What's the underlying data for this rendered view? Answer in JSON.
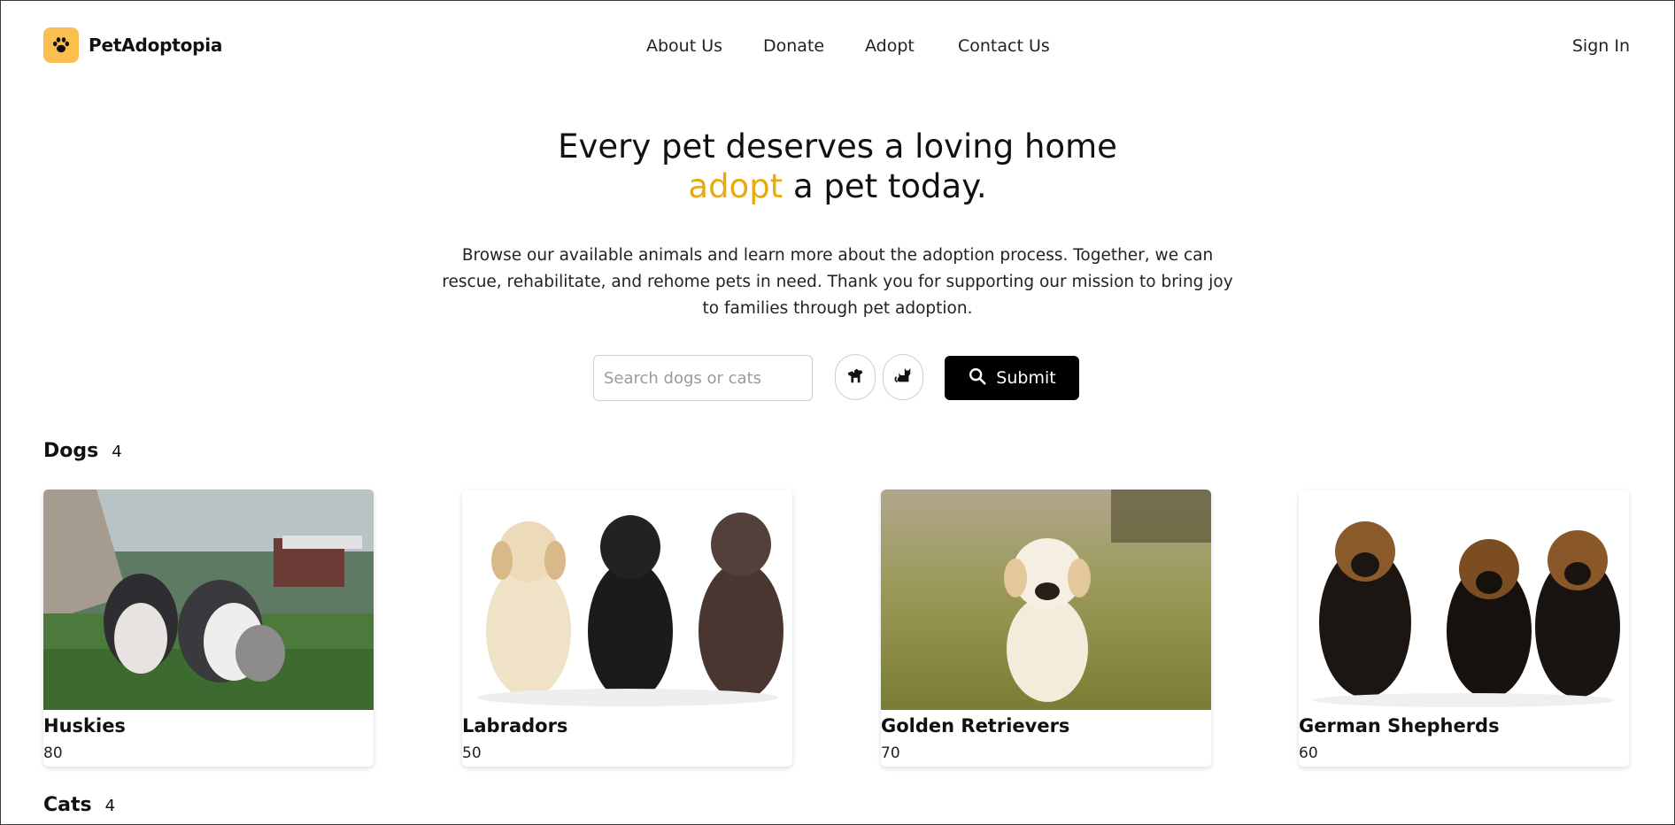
{
  "header": {
    "logo_text": "PetAdoptopia",
    "logo_icon": "paw-icon",
    "nav": [
      "About Us",
      "Donate",
      "Adopt",
      "Contact Us"
    ],
    "signin": "Sign In"
  },
  "hero": {
    "line1": "Every pet deserves a loving home",
    "accent": "adopt",
    "line2_rest": " a pet today.",
    "description": "Browse our available animals and learn more about the adoption process. Together, we can rescue, rehabilitate, and rehome pets in need. Thank you for supporting our mission to bring joy to families through pet adoption."
  },
  "search": {
    "placeholder": "Search dogs or cats",
    "value": "",
    "dog_icon": "dog-icon",
    "cat_icon": "cat-icon",
    "submit_label": "Submit",
    "submit_icon": "search-icon"
  },
  "dogs": {
    "title": "Dogs",
    "count": "4",
    "items": [
      {
        "name": "Huskies",
        "count": "80"
      },
      {
        "name": "Labradors",
        "count": "50"
      },
      {
        "name": "Golden Retrievers",
        "count": "70"
      },
      {
        "name": "German Shepherds",
        "count": "60"
      }
    ]
  },
  "cats": {
    "title": "Cats",
    "count": "4"
  },
  "colors": {
    "accent": "#e8a912",
    "logo_bg": "#fbbf4f",
    "button_bg": "#000000"
  }
}
